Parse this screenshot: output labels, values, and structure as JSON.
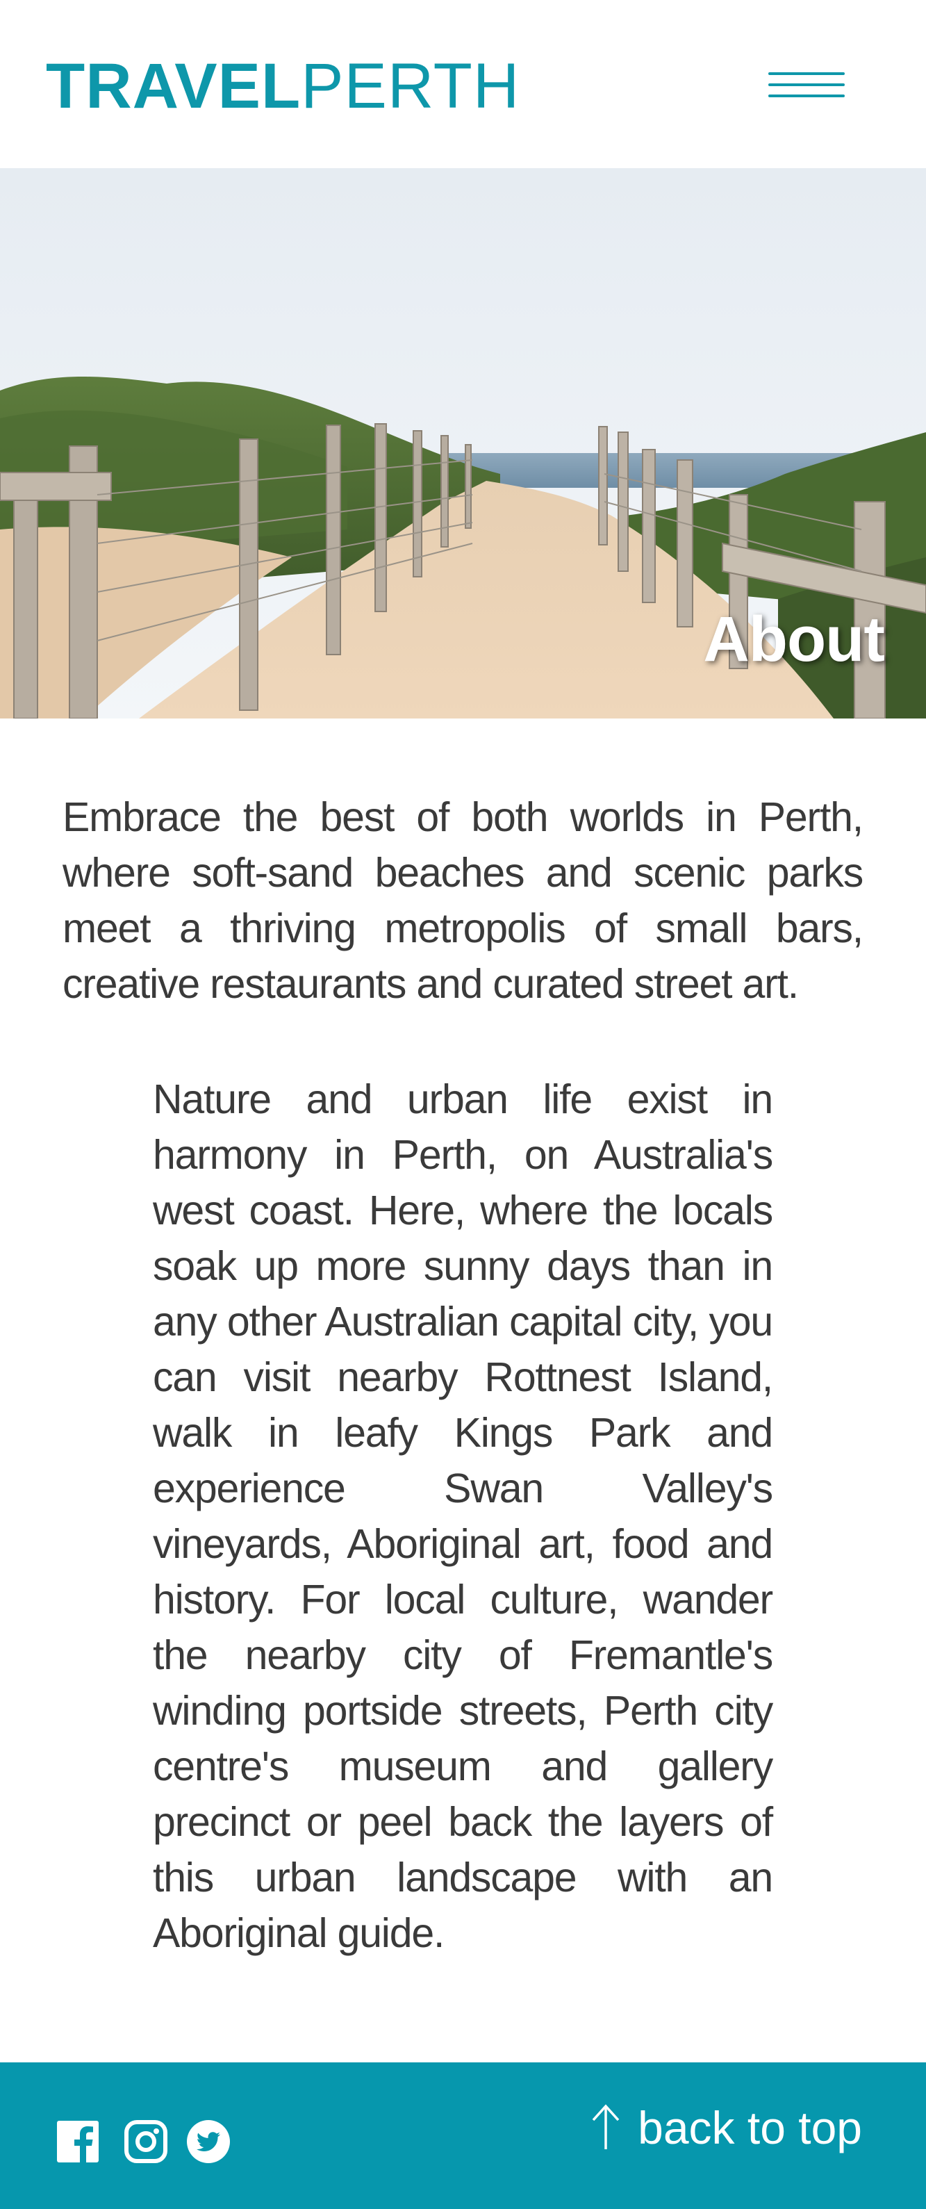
{
  "header": {
    "logo_bold": "TRAVEL",
    "logo_light": "PERTH",
    "menu_icon": "hamburger-menu-icon"
  },
  "hero": {
    "title": "About",
    "image": "sandy-beach-path-with-wooden-fences"
  },
  "content": {
    "intro": "Embrace the best of both worlds in Perth, where soft-sand beaches and scenic parks meet a thriving metropolis of small bars, creative restaurants and curated street art.",
    "body": "Nature and urban life exist in harmony in Perth, on Australia's west coast. Here, where the locals soak up more sunny days than in any other Australian capital city, you can visit nearby Rottnest Island, walk in leafy Kings Park and experience Swan Valley's vineyards, Aboriginal art, food and history. For local culture, wander the nearby city of Fremantle's winding portside streets, Perth city centre's museum and gallery precinct or peel back the layers of this urban landscape with an Aboriginal guide."
  },
  "footer": {
    "social": [
      "facebook-icon",
      "instagram-icon",
      "twitter-icon"
    ],
    "back_to_top": "back to top",
    "back_to_top_icon": "arrow-up-icon"
  },
  "colors": {
    "brand": "#0e97aa",
    "footer_bg": "#0697ad",
    "text": "#3a3a3a"
  }
}
